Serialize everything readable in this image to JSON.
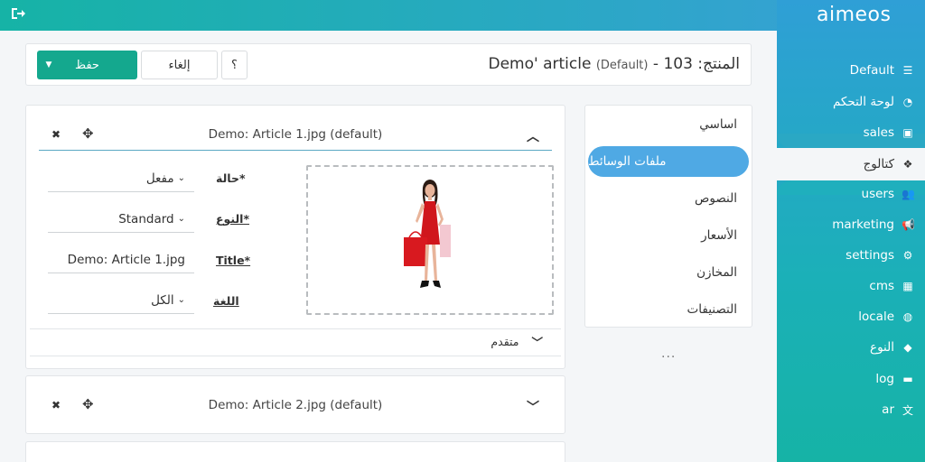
{
  "brand": {
    "logo_text": "aimeos",
    "accent": "#16b3a6",
    "save_color": "#14a88e",
    "active_tab_color": "#4fa9e4"
  },
  "topbar": {
    "logout_icon": "sign-out-icon"
  },
  "sidebar": {
    "items": [
      {
        "label": "Default",
        "icon": "list-icon",
        "active": false
      },
      {
        "label": "لوحة التحكم",
        "icon": "dashboard-icon",
        "active": false
      },
      {
        "label": "sales",
        "icon": "money-icon",
        "active": false
      },
      {
        "label": "كتالوج",
        "icon": "cubes-icon",
        "active": true
      },
      {
        "label": "users",
        "icon": "users-icon",
        "active": false
      },
      {
        "label": "marketing",
        "icon": "bullhorn-icon",
        "active": false
      },
      {
        "label": "settings",
        "icon": "cogs-icon",
        "active": false
      },
      {
        "label": "cms",
        "icon": "grid-icon",
        "active": false
      },
      {
        "label": "locale",
        "icon": "globe-icon",
        "active": false
      },
      {
        "label": "النوع",
        "icon": "tag-icon",
        "active": false
      },
      {
        "label": "log",
        "icon": "archive-icon",
        "active": false
      },
      {
        "label": "ar",
        "icon": "language-icon",
        "active": false
      }
    ]
  },
  "header": {
    "save_label": "حفظ",
    "cancel_label": "إلغاء",
    "help_label": "؟",
    "title_prefix": "المنتج: 103 - ",
    "title_name": "Demo' article",
    "title_site": "(Default)"
  },
  "tabs": [
    {
      "label": "اساسي",
      "active": false
    },
    {
      "label": "ملفات الوسائط",
      "active": true
    },
    {
      "label": "النصوص",
      "active": false
    },
    {
      "label": "الأسعار",
      "active": false
    },
    {
      "label": "المخازن",
      "active": false
    },
    {
      "label": "التصنيفات",
      "active": false
    }
  ],
  "more_label": "...",
  "media": [
    {
      "title": "Demo: Article 1.jpg (default)",
      "expanded": true,
      "fields": {
        "status": {
          "label": "حالة*",
          "value": "مفعل"
        },
        "type": {
          "label": "النوع*",
          "value": "Standard"
        },
        "title": {
          "label": "Title*",
          "value": "Demo: Article 1.jpg"
        },
        "language": {
          "label": "اللغة",
          "value": "الكل"
        }
      },
      "advanced_label": "متقدم"
    },
    {
      "title": "Demo: Article 2.jpg (default)",
      "expanded": false
    }
  ]
}
